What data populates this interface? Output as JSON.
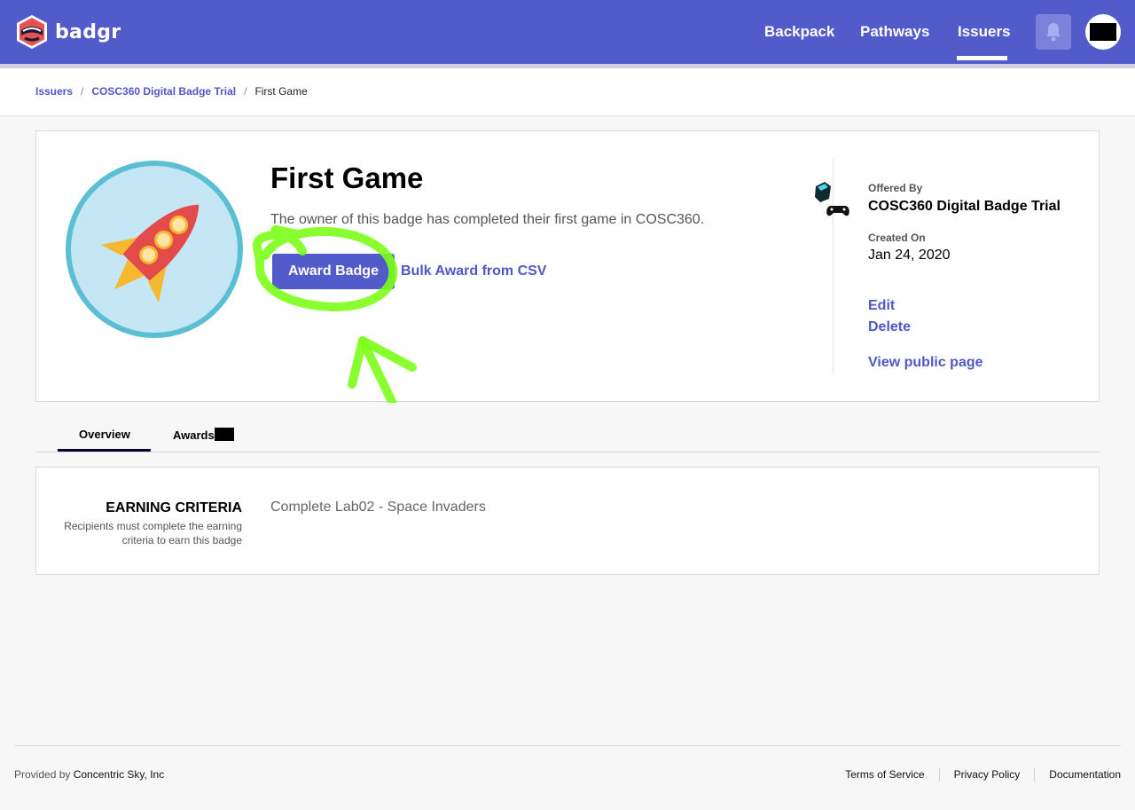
{
  "app": {
    "name": "badgr"
  },
  "nav": {
    "links": [
      "Backpack",
      "Pathways",
      "Issuers"
    ],
    "active": "Issuers"
  },
  "breadcrumb": {
    "items": [
      "Issuers",
      "COSC360 Digital Badge Trial"
    ],
    "current": "First Game"
  },
  "badge": {
    "title": "First Game",
    "description": "The owner of this badge has completed their first game in COSC360.",
    "award_button": "Award Badge",
    "bulk_award_link": "Bulk Award from CSV",
    "image_icon": "rocket-icon"
  },
  "sidebar": {
    "offered_by_label": "Offered By",
    "issuer_name": "COSC360 Digital Badge Trial",
    "created_on_label": "Created On",
    "created_on": "Jan 24, 2020",
    "edit": "Edit",
    "delete": "Delete",
    "view_public": "View public page"
  },
  "tabs": {
    "overview": "Overview",
    "awards": "Awards"
  },
  "criteria": {
    "title": "EARNING CRITERIA",
    "subtitle": "Recipients must complete the earning criteria to earn this badge",
    "text": "Complete Lab02 - Space Invaders"
  },
  "footer": {
    "provided_by": "Provided by",
    "company": "Concentric Sky, Inc",
    "links": [
      "Terms of Service",
      "Privacy Policy",
      "Documentation"
    ]
  },
  "colors": {
    "brand": "#515bc9",
    "link": "#4f58c6",
    "annotation": "#7cff1a"
  }
}
